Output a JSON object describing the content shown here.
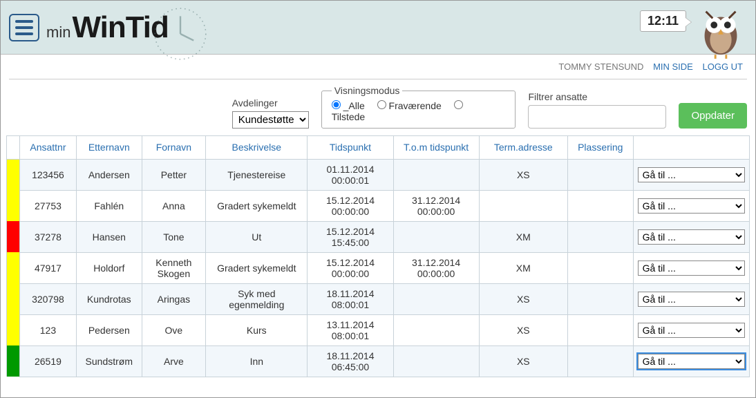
{
  "header": {
    "logo_prefix": "min",
    "logo_main": "WinTid",
    "clock": "12:11"
  },
  "userbar": {
    "username": "TOMMY STENSUND",
    "link_mypage": "MIN SIDE",
    "link_logout": "LOGG UT"
  },
  "controls": {
    "dept_label": "Avdelinger",
    "dept_selected": "Kundestøtte",
    "viewmode_legend": "Visningsmodus",
    "viewmode_options": {
      "all": "_Alle",
      "away": "Fraværende",
      "present": "Tilstede"
    },
    "filter_label": "Filtrer ansatte",
    "filter_value": "",
    "update_label": "Oppdater"
  },
  "table": {
    "headers": {
      "id": "Ansattnr",
      "lastname": "Etternavn",
      "firstname": "Fornavn",
      "desc": "Beskrivelse",
      "time": "Tidspunkt",
      "time_to": "T.o.m tidspunkt",
      "term": "Term.adresse",
      "place": "Plassering",
      "action_placeholder": "Gå til ..."
    },
    "rows": [
      {
        "status": "yellow",
        "id": "123456",
        "lastname": "Andersen",
        "firstname": "Petter",
        "desc": "Tjenestereise",
        "t1a": "01.11.2014",
        "t1b": "00:00:01",
        "t2a": "",
        "t2b": "",
        "term": "XS",
        "place": ""
      },
      {
        "status": "yellow",
        "id": "27753",
        "lastname": "Fahlén",
        "firstname": "Anna",
        "desc": "Gradert sykemeldt",
        "t1a": "15.12.2014",
        "t1b": "00:00:00",
        "t2a": "31.12.2014",
        "t2b": "00:00:00",
        "term": "",
        "place": ""
      },
      {
        "status": "red",
        "id": "37278",
        "lastname": "Hansen",
        "firstname": "Tone",
        "desc": "Ut",
        "t1a": "15.12.2014",
        "t1b": "15:45:00",
        "t2a": "",
        "t2b": "",
        "term": "XM",
        "place": ""
      },
      {
        "status": "yellow",
        "id": "47917",
        "lastname": "Holdorf",
        "firstname": "Kenneth Skogen",
        "desc": "Gradert sykemeldt",
        "t1a": "15.12.2014",
        "t1b": "00:00:00",
        "t2a": "31.12.2014",
        "t2b": "00:00:00",
        "term": "XM",
        "place": ""
      },
      {
        "status": "yellow",
        "id": "320798",
        "lastname": "Kundrotas",
        "firstname": "Aringas",
        "desc": "Syk med egenmelding",
        "t1a": "18.11.2014",
        "t1b": "08:00:01",
        "t2a": "",
        "t2b": "",
        "term": "XS",
        "place": ""
      },
      {
        "status": "yellow",
        "id": "123",
        "lastname": "Pedersen",
        "firstname": "Ove",
        "desc": "Kurs",
        "t1a": "13.11.2014",
        "t1b": "08:00:01",
        "t2a": "",
        "t2b": "",
        "term": "XS",
        "place": ""
      },
      {
        "status": "green",
        "id": "26519",
        "lastname": "Sundstrøm",
        "firstname": "Arve",
        "desc": "Inn",
        "t1a": "18.11.2014",
        "t1b": "06:45:00",
        "t2a": "",
        "t2b": "",
        "term": "XS",
        "place": ""
      }
    ]
  }
}
